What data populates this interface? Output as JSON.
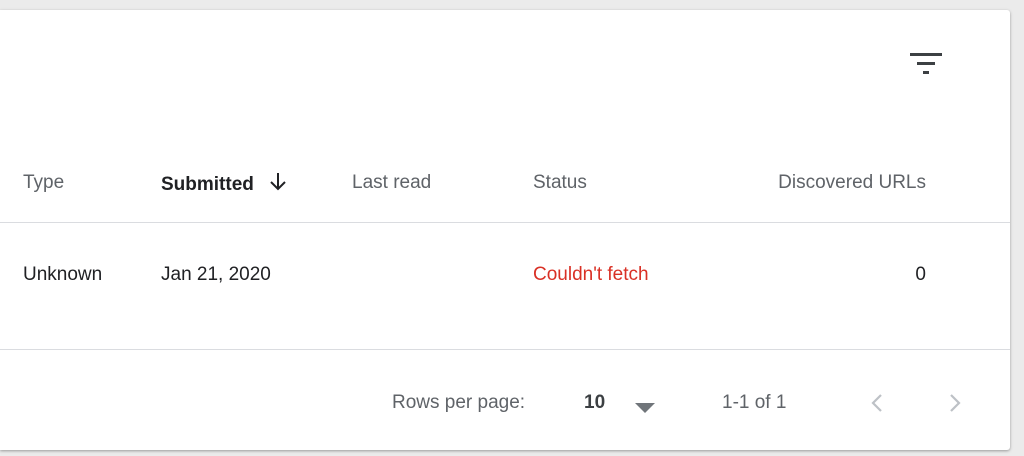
{
  "toolbar": {
    "filter_icon": "filter-list-icon"
  },
  "table": {
    "columns": [
      {
        "label": "Type"
      },
      {
        "label": "Submitted",
        "sorted": "descending"
      },
      {
        "label": "Last read"
      },
      {
        "label": "Status"
      },
      {
        "label": "Discovered URLs"
      }
    ],
    "rows": [
      {
        "type": "Unknown",
        "submitted": "Jan 21, 2020",
        "last_read": "",
        "status": "Couldn't fetch",
        "discovered_urls": "0"
      }
    ]
  },
  "pagination": {
    "rows_per_page_label": "Rows per page:",
    "rows_per_page_value": "10",
    "range_text": "1-1 of 1"
  },
  "colors": {
    "status_error": "#d93025",
    "header_text": "#5f6368",
    "body_text": "#202124",
    "disabled_icon": "#bdc1c6"
  }
}
